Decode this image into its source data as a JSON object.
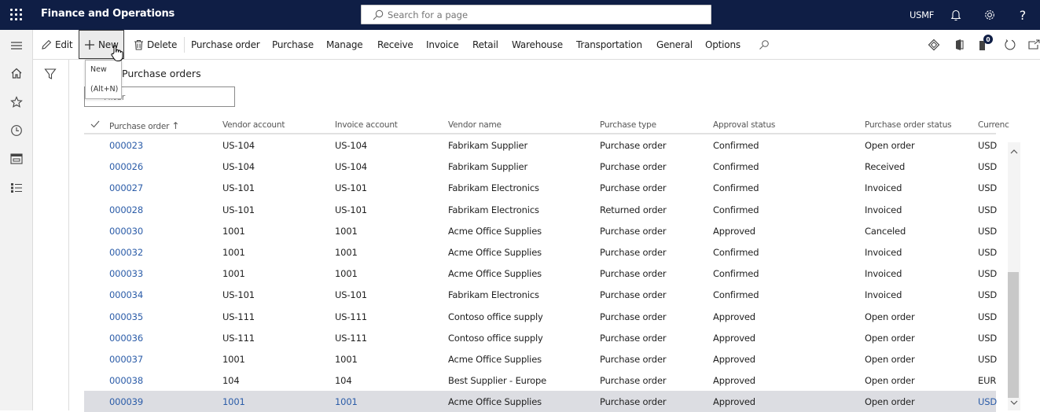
{
  "app": {
    "title": "Finance and Operations",
    "search_placeholder": "Search for a page",
    "company": "USMF"
  },
  "actions": {
    "edit": "Edit",
    "new": "New",
    "delete": "Delete",
    "menus": [
      "Purchase order",
      "Purchase",
      "Manage",
      "Receive",
      "Invoice",
      "Retail",
      "Warehouse",
      "Transportation",
      "General",
      "Options"
    ],
    "notification_count": "0"
  },
  "tooltip": {
    "label": "New",
    "shortcut": "(Alt+N)"
  },
  "page": {
    "title": "Purchase orders",
    "filter_placeholder": "Filter"
  },
  "grid": {
    "columns": [
      "Purchase order",
      "Vendor account",
      "Invoice account",
      "Vendor name",
      "Purchase type",
      "Approval status",
      "Purchase order status",
      "Currenc"
    ],
    "sort_indicator": "↑",
    "rows": [
      [
        "000023",
        "US-104",
        "US-104",
        "Fabrikam Supplier",
        "Purchase order",
        "Confirmed",
        "Open order",
        "USD"
      ],
      [
        "000026",
        "US-104",
        "US-104",
        "Fabrikam Supplier",
        "Purchase order",
        "Confirmed",
        "Received",
        "USD"
      ],
      [
        "000027",
        "US-101",
        "US-101",
        "Fabrikam Electronics",
        "Purchase order",
        "Confirmed",
        "Invoiced",
        "USD"
      ],
      [
        "000028",
        "US-101",
        "US-101",
        "Fabrikam Electronics",
        "Returned order",
        "Confirmed",
        "Invoiced",
        "USD"
      ],
      [
        "000030",
        "1001",
        "1001",
        "Acme Office Supplies",
        "Purchase order",
        "Approved",
        "Canceled",
        "USD"
      ],
      [
        "000032",
        "1001",
        "1001",
        "Acme Office Supplies",
        "Purchase order",
        "Confirmed",
        "Invoiced",
        "USD"
      ],
      [
        "000033",
        "1001",
        "1001",
        "Acme Office Supplies",
        "Purchase order",
        "Confirmed",
        "Invoiced",
        "USD"
      ],
      [
        "000034",
        "US-101",
        "US-101",
        "Fabrikam Electronics",
        "Purchase order",
        "Confirmed",
        "Invoiced",
        "USD"
      ],
      [
        "000035",
        "US-111",
        "US-111",
        "Contoso office supply",
        "Purchase order",
        "Approved",
        "Open order",
        "USD"
      ],
      [
        "000036",
        "US-111",
        "US-111",
        "Contoso office supply",
        "Purchase order",
        "Approved",
        "Open order",
        "USD"
      ],
      [
        "000037",
        "1001",
        "1001",
        "Acme Office Supplies",
        "Purchase order",
        "Approved",
        "Open order",
        "USD"
      ],
      [
        "000038",
        "104",
        "104",
        "Best Supplier - Europe",
        "Purchase order",
        "Approved",
        "Open order",
        "EUR"
      ],
      [
        "000039",
        "1001",
        "1001",
        "Acme Office Supplies",
        "Purchase order",
        "Approved",
        "Open order",
        "USD"
      ]
    ],
    "selected_row": 12
  },
  "colors": {
    "topbar": "#0f1e45",
    "link": "#2b5ca8",
    "selected_row": "#dcdde2"
  }
}
